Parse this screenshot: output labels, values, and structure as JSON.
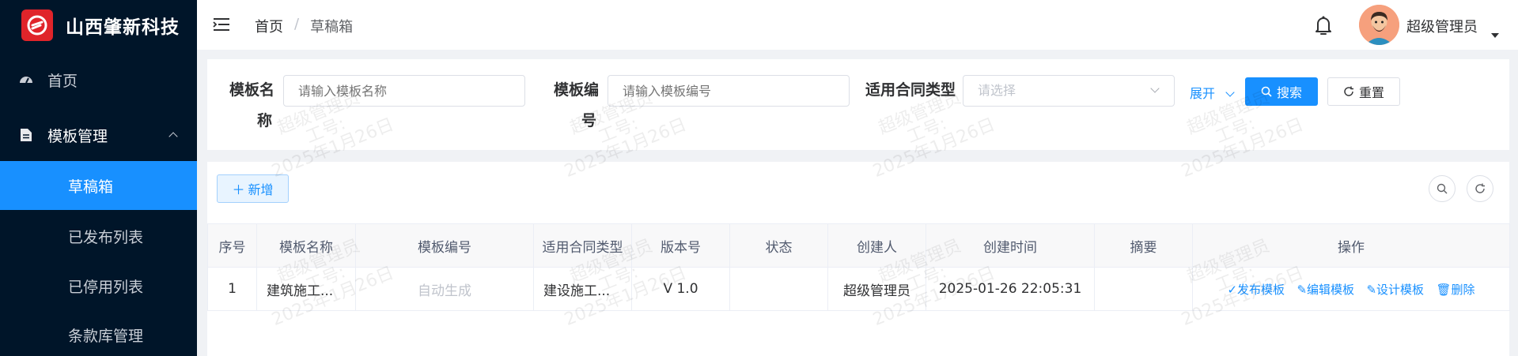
{
  "brand": {
    "name": "山西肇新科技",
    "accent": "#e0242a"
  },
  "sidebar": {
    "items": [
      {
        "label": "首页",
        "icon": "dashboard-icon"
      },
      {
        "label": "模板管理",
        "icon": "document-icon"
      },
      {
        "label": "草稿箱"
      },
      {
        "label": "已发布列表"
      },
      {
        "label": "已停用列表"
      },
      {
        "label": "条款库管理"
      }
    ],
    "active_color": "#1890ff"
  },
  "header": {
    "breadcrumb": [
      "首页",
      "/",
      "草稿箱"
    ],
    "username": "超级管理员"
  },
  "search": {
    "fields": [
      {
        "label_line1": "模板名",
        "label_line2": "称",
        "placeholder": "请输入模板名称"
      },
      {
        "label_line1": "模板编",
        "label_line2": "号",
        "placeholder": "请输入模板编号"
      },
      {
        "label": "适用合同类型",
        "placeholder": "请选择"
      }
    ],
    "expand_label": "展开",
    "search_label": "搜索",
    "reset_label": "重置"
  },
  "toolbar": {
    "new_label": "新增"
  },
  "table": {
    "columns": [
      "序号",
      "模板名称",
      "模板编号",
      "适用合同类型",
      "版本号",
      "状态",
      "创建人",
      "创建时间",
      "摘要",
      "操作"
    ],
    "rows": [
      {
        "index": "1",
        "name": "建筑施工...",
        "code": "自动生成",
        "contract_type": "建设施工...",
        "version": "V 1.0",
        "status": "",
        "creator": "超级管理员",
        "created_at": "2025-01-26 22:05:31",
        "summary": "",
        "actions": [
          "发布模板",
          "编辑模板",
          "设计模板",
          "删除"
        ]
      }
    ]
  },
  "watermark": {
    "line1": "超级管理员",
    "line2": "工号:",
    "line3": "2025年1月26日"
  }
}
